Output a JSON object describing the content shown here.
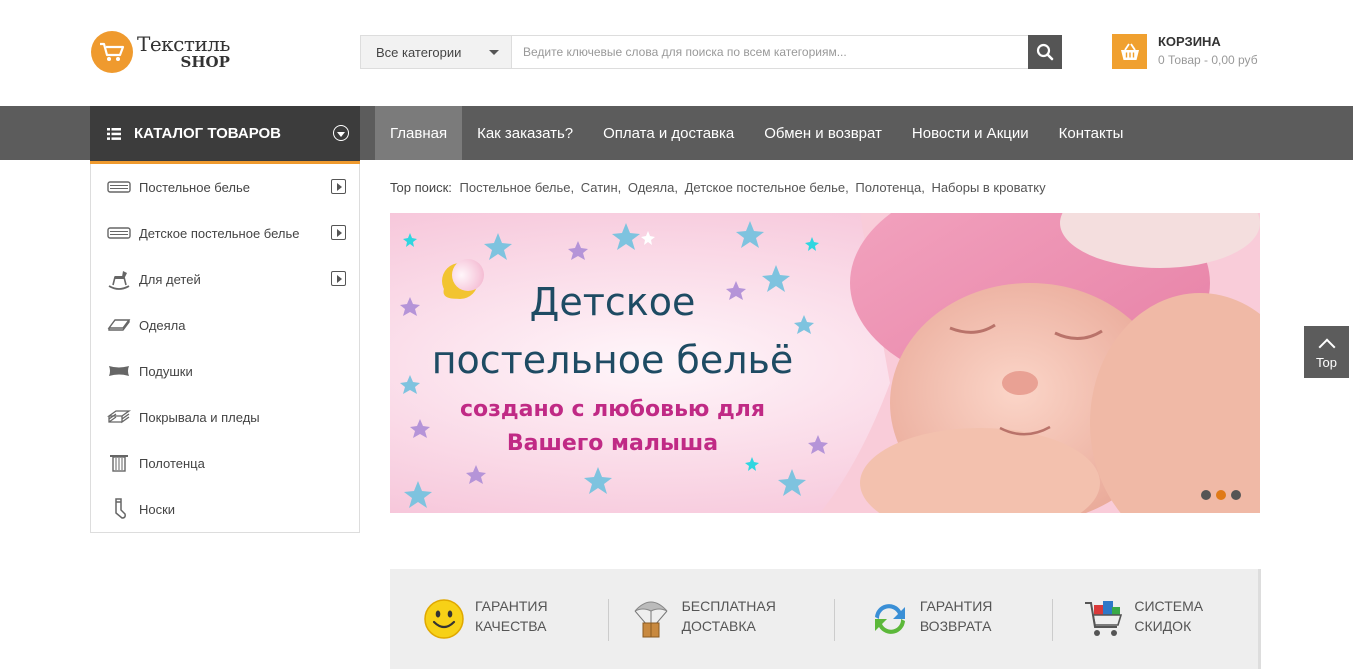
{
  "logo": {
    "title": "Текстиль",
    "sub": "SHOP"
  },
  "search": {
    "category": "Все категории",
    "placeholder": "Ведите ключевые слова для поиска по всем категориям..."
  },
  "cart": {
    "title": "КОРЗИНА",
    "summary": "0 Товар - 0,00 руб"
  },
  "catalog": {
    "label": "КАТАЛОГ ТОВАРОВ"
  },
  "menu": [
    {
      "label": "Главная"
    },
    {
      "label": "Как заказать?"
    },
    {
      "label": "Оплата и доставка"
    },
    {
      "label": "Обмен и возврат"
    },
    {
      "label": "Новости и Акции"
    },
    {
      "label": "Контакты"
    }
  ],
  "sidebar": {
    "items": [
      {
        "label": "Постельное белье",
        "icon": "bedding-icon"
      },
      {
        "label": "Детское постельное белье",
        "icon": "bedding-icon"
      },
      {
        "label": "Для детей",
        "icon": "rocking-horse-icon"
      },
      {
        "label": "Одеяла",
        "icon": "blanket-icon"
      },
      {
        "label": "Подушки",
        "icon": "pillow-icon"
      },
      {
        "label": "Покрывала и пледы",
        "icon": "bedspread-icon"
      },
      {
        "label": "Полотенца",
        "icon": "towel-icon"
      },
      {
        "label": "Носки",
        "icon": "sock-icon"
      }
    ]
  },
  "top_search": {
    "label": "Top поиск:",
    "links": [
      "Постельное белье,",
      "Сатин,",
      "Одеяла,",
      "Детское постельное белье,",
      "Полотенца,",
      "Наборы в кроватку"
    ]
  },
  "banner": {
    "line1": "Детское",
    "line2": "постельное бельё",
    "line3": "создано с любовью для",
    "line4": "Вашего малыша"
  },
  "top_button": {
    "label": "Top"
  },
  "features": [
    {
      "line1": "Гарантия",
      "line2": "качества"
    },
    {
      "line1": "Бесплатная",
      "line2": "доставка"
    },
    {
      "line1": "Гарантия",
      "line2": "возврата"
    },
    {
      "line1": "Система",
      "line2": "скидок"
    }
  ],
  "colors": {
    "accent": "#ef9a2e",
    "nav": "#5c5c5c",
    "catalog": "#3c3c3c"
  }
}
